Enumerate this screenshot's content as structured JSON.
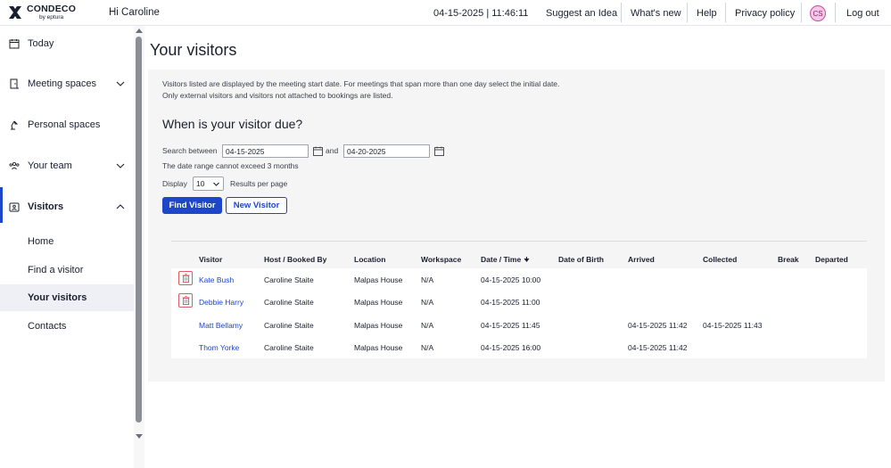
{
  "header": {
    "logo_name": "CONDECO",
    "logo_sub": "by eptura",
    "greeting": "Hi Caroline",
    "datetime": "04-15-2025 | 11:46:11",
    "nav": [
      "Suggest an Idea",
      "What's new",
      "Help",
      "Privacy policy"
    ],
    "avatar_initials": "CS",
    "logout": "Log out"
  },
  "sidebar": {
    "items": [
      {
        "label": "Today",
        "icon": "calendar-icon"
      },
      {
        "label": "Meeting spaces",
        "icon": "door-icon"
      },
      {
        "label": "Personal spaces",
        "icon": "desk-lamp-icon"
      },
      {
        "label": "Your team",
        "icon": "team-icon"
      },
      {
        "label": "Visitors",
        "icon": "visitor-badge-icon"
      }
    ],
    "visitors_sub": [
      "Home",
      "Find a visitor",
      "Your visitors",
      "Contacts"
    ]
  },
  "main": {
    "title": "Your visitors",
    "info_line1": "Visitors listed are displayed by the meeting start date. For meetings that span more than one day select the initial date.",
    "info_line2": "Only external visitors and visitors not attached to bookings are listed.",
    "due_title": "When is your visitor due?",
    "search_between_label": "Search between",
    "from_date": "04-15-2025",
    "and_label": "and",
    "to_date": "04-20-2025",
    "range_note": "The date range cannot exceed 3 months",
    "display_label": "Display",
    "display_value": "10",
    "per_page_label": "Results per page",
    "find_button": "Find Visitor",
    "new_button": "New Visitor"
  },
  "table": {
    "headers": [
      "Visitor",
      "Host / Booked By",
      "Location",
      "Workspace",
      "Date / Time",
      "Date of Birth",
      "Arrived",
      "Collected",
      "Break",
      "Departed"
    ],
    "rows": [
      {
        "visitor": "Kate Bush",
        "host": "Caroline Staite",
        "location": "Malpas House",
        "workspace": "N/A",
        "datetime": "04-15-2025 10:00",
        "dob": "",
        "arrived": "",
        "collected": "",
        "break": "",
        "departed": "",
        "deletable": true
      },
      {
        "visitor": "Debbie Harry",
        "host": "Caroline Staite",
        "location": "Malpas House",
        "workspace": "N/A",
        "datetime": "04-15-2025 11:00",
        "dob": "",
        "arrived": "",
        "collected": "",
        "break": "",
        "departed": "",
        "deletable": true
      },
      {
        "visitor": "Matt Bellamy",
        "host": "Caroline Staite",
        "location": "Malpas House",
        "workspace": "N/A",
        "datetime": "04-15-2025 11:45",
        "dob": "",
        "arrived": "04-15-2025 11:42",
        "collected": "04-15-2025 11:43",
        "break": "",
        "departed": "",
        "deletable": false
      },
      {
        "visitor": "Thom Yorke",
        "host": "Caroline Staite",
        "location": "Malpas House",
        "workspace": "N/A",
        "datetime": "04-15-2025 16:00",
        "dob": "",
        "arrived": "04-15-2025 11:42",
        "collected": "",
        "break": "",
        "departed": "",
        "deletable": false
      }
    ]
  },
  "colors": {
    "accent": "#1d46c8",
    "delete_red": "#e05a63",
    "panel_bg": "#f5f5f5"
  }
}
